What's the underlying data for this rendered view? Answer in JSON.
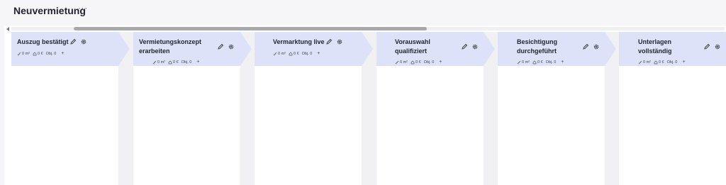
{
  "page": {
    "title": "Neuvermietung",
    "more_label": "···"
  },
  "columns": [
    {
      "title": "Auszug bestätigt",
      "area": "0 m²",
      "rent": "0 €",
      "objects": "Obj. 0",
      "plus": "+"
    },
    {
      "title": "Vermietungskonzept erarbeiten",
      "area": "0 m²",
      "rent": "0 €",
      "objects": "Obj. 0",
      "plus": "+"
    },
    {
      "title": "Vermarktung live",
      "area": "0 m²",
      "rent": "0 €",
      "objects": "Obj. 0",
      "plus": "+"
    },
    {
      "title": "Vorauswahl qualifiziert",
      "area": "0 m²",
      "rent": "0 €",
      "objects": "Obj. 0",
      "plus": "+"
    },
    {
      "title": "Besichtigung durchgeführt",
      "area": "0 m²",
      "rent": "0 €",
      "objects": "Obj. 0",
      "plus": "+"
    },
    {
      "title": "Unterlagen vollständig",
      "area": "0 m²",
      "rent": "0 €",
      "objects": "Obj. 0",
      "plus": "+"
    }
  ],
  "colors": {
    "header_bg": "#dde2f8",
    "board_bg": "#f1f1f3",
    "card_bg": "#ffffff"
  },
  "icons": {
    "edit": "pencil-icon",
    "settings": "gear-icon",
    "area": "ruler-icon",
    "rent": "house-icon"
  }
}
